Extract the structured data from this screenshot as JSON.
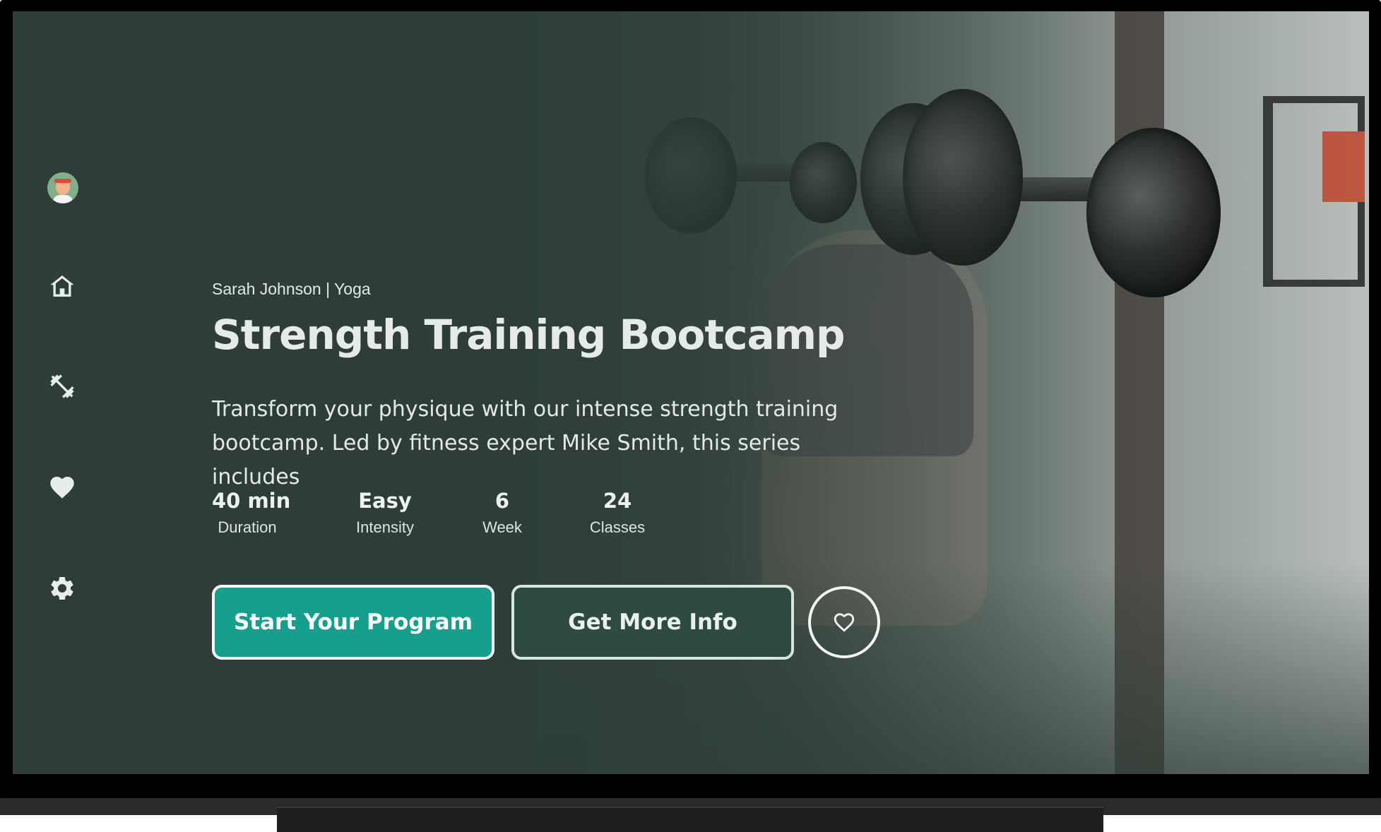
{
  "user": {
    "avatar_icon": "avatar-icon"
  },
  "nav": {
    "items": [
      {
        "id": "home",
        "icon": "home-icon"
      },
      {
        "id": "workouts",
        "icon": "dumbbell-icon"
      },
      {
        "id": "favorites",
        "icon": "heart-icon"
      },
      {
        "id": "settings",
        "icon": "gear-icon"
      }
    ]
  },
  "program": {
    "byline": "Sarah Johnson | Yoga",
    "title": "Strength Training Bootcamp",
    "description": "Transform your physique with our intense strength training bootcamp. Led by fitness expert Mike Smith, this series includes",
    "stats": [
      {
        "value": "40 min",
        "label": "Duration"
      },
      {
        "value": "Easy",
        "label": "Intensity"
      },
      {
        "value": "6",
        "label": "Week"
      },
      {
        "value": "24",
        "label": "Classes"
      }
    ]
  },
  "actions": {
    "start_label": "Start Your Program",
    "info_label": "Get More Info",
    "favorite_icon": "heart-outline-icon"
  },
  "colors": {
    "background": "#2e3d37",
    "primary_button": "#14a08c",
    "secondary_button": "#2e4a41",
    "text": "#e9eeeb"
  }
}
